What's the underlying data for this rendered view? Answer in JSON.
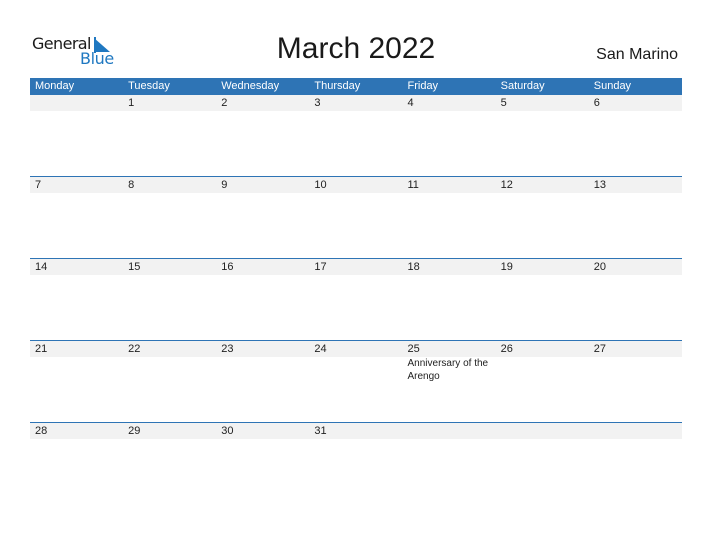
{
  "logo": {
    "word1": "General",
    "word2": "Blue"
  },
  "title": "March 2022",
  "country": "San Marino",
  "colors": {
    "accent": "#2e74b5",
    "strip": "#f2f2f2",
    "logo_blue": "#1f78c1"
  },
  "weekdays": [
    "Monday",
    "Tuesday",
    "Wednesday",
    "Thursday",
    "Friday",
    "Saturday",
    "Sunday"
  ],
  "weeks": [
    {
      "days": [
        "",
        "1",
        "2",
        "3",
        "4",
        "5",
        "6"
      ],
      "events": [
        "",
        "",
        "",
        "",
        "",
        "",
        ""
      ]
    },
    {
      "days": [
        "7",
        "8",
        "9",
        "10",
        "11",
        "12",
        "13"
      ],
      "events": [
        "",
        "",
        "",
        "",
        "",
        "",
        ""
      ]
    },
    {
      "days": [
        "14",
        "15",
        "16",
        "17",
        "18",
        "19",
        "20"
      ],
      "events": [
        "",
        "",
        "",
        "",
        "",
        "",
        ""
      ]
    },
    {
      "days": [
        "21",
        "22",
        "23",
        "24",
        "25",
        "26",
        "27"
      ],
      "events": [
        "",
        "",
        "",
        "",
        "Anniversary of the Arengo",
        "",
        ""
      ]
    },
    {
      "days": [
        "28",
        "29",
        "30",
        "31",
        "",
        "",
        ""
      ],
      "events": [
        "",
        "",
        "",
        "",
        "",
        "",
        ""
      ]
    }
  ]
}
